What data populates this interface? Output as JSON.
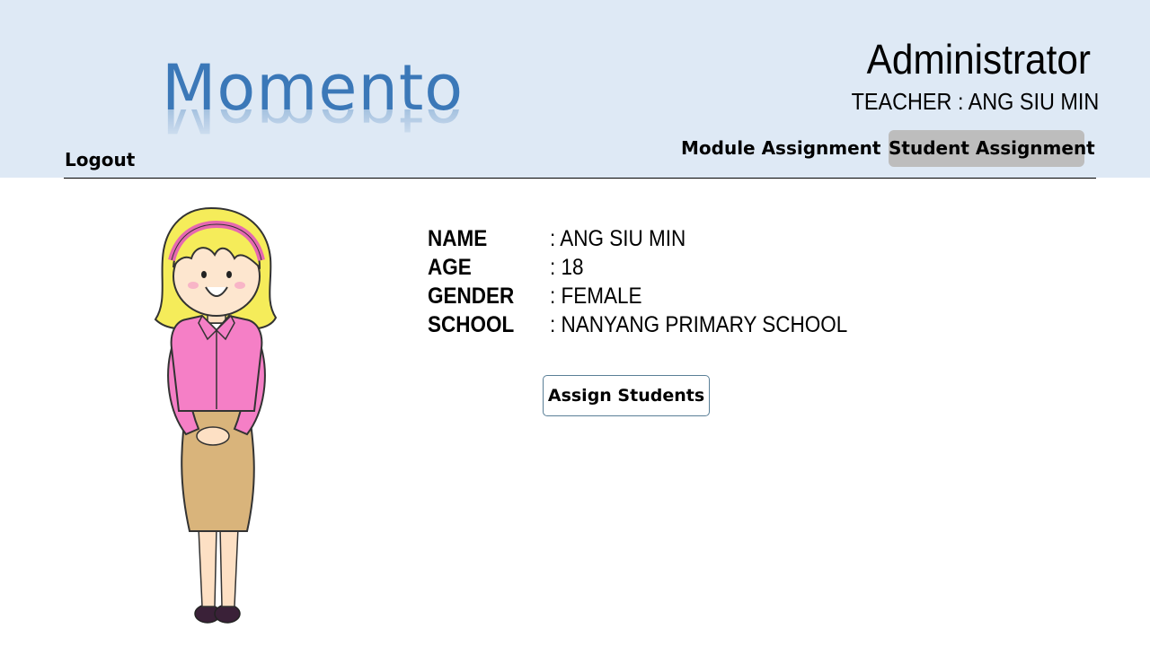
{
  "app": {
    "logo_text": "Momento"
  },
  "header": {
    "role": "Administrator",
    "teacher_line": "TEACHER : ANG SIU MIN",
    "logout_label": "Logout"
  },
  "nav": {
    "module_assignment": "Module Assignment",
    "student_assignment": "Student Assignment"
  },
  "profile": {
    "fields": [
      {
        "label": "NAME",
        "value": ": ANG SIU MIN"
      },
      {
        "label": "AGE",
        "value": ": 18"
      },
      {
        "label": "GENDER",
        "value": ": FEMALE"
      },
      {
        "label": "SCHOOL",
        "value": ": NANYANG PRIMARY SCHOOL"
      }
    ],
    "assign_button": "Assign Students",
    "avatar_icon": "teacher-avatar-illustration"
  },
  "colors": {
    "header_bg": "#dee9f5",
    "logo": "#3b78b8",
    "active_tab": "#bdbdbd",
    "button_border": "#5a7f97"
  }
}
